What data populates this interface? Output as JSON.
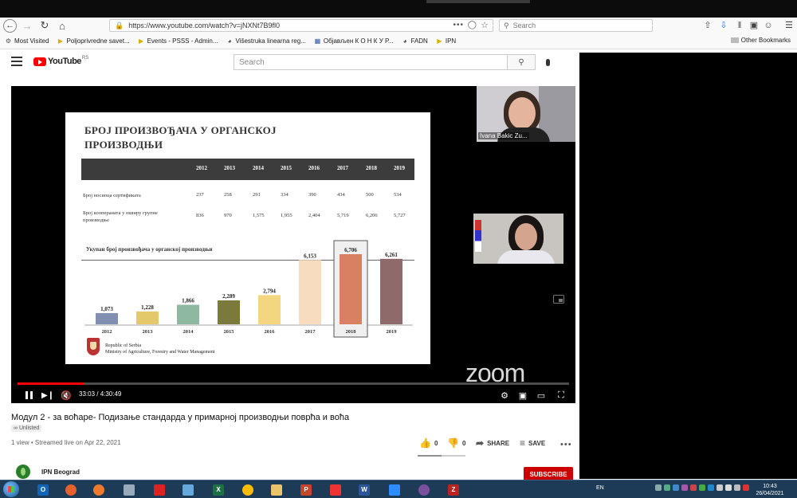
{
  "browser": {
    "url": "https://www.youtube.com/watch?v=jNXNt7B9fl0",
    "search_placeholder": "Search",
    "bookmarks": [
      {
        "label": "Most Visited",
        "icon": "gear-icon",
        "color": "#555555"
      },
      {
        "label": "Poljoprivredne savet...",
        "icon": "star-icon",
        "color": "#d8b000"
      },
      {
        "label": "Events - PSSS - Admin...",
        "icon": "star-icon",
        "color": "#d8b000"
      },
      {
        "label": "Višestruka linearna reg...",
        "icon": "globe-icon",
        "color": "#444444"
      },
      {
        "label": "Објављен К О Н К У Р...",
        "icon": "page-icon",
        "color": "#3355aa"
      },
      {
        "label": "FADN",
        "icon": "globe-icon",
        "color": "#444444"
      },
      {
        "label": "IPN",
        "icon": "star-icon",
        "color": "#d8b000"
      }
    ],
    "other_bookmarks": "Other Bookmarks"
  },
  "youtube": {
    "logo_text": "YouTube",
    "region": "RS",
    "search_placeholder": "Search",
    "video_title": "Модул 2 - за воћаре- Подизање стандарда у примарној производњи поврћа и воћа",
    "visibility": "Unlisted",
    "views_line": "1 view • Streamed live on Apr 22, 2021",
    "likes": "0",
    "dislikes": "0",
    "share_label": "SHARE",
    "save_label": "SAVE",
    "channel_name": "IPN Beograd",
    "subscribe_label": "SUBSCRIBE",
    "time_display": "33:03 / 4:30:49",
    "progress": 0.122
  },
  "slide": {
    "title_line1": "БРОЈ ПРОИЗВОЂАЧА У ОРГАНСКОЈ",
    "title_line2": "ПРОИЗВОДЊИ",
    "years": [
      "2012",
      "2013",
      "2014",
      "2015",
      "2016",
      "2017",
      "2018",
      "2019"
    ],
    "rows": [
      {
        "label": "Број носиоца сертификата",
        "label2": "",
        "values": [
          "237",
          "258",
          "291",
          "334",
          "390",
          "434",
          "500",
          "534"
        ]
      },
      {
        "label": "Број коопераната у оквиру групне",
        "label2": "производње",
        "values": [
          "836",
          "970",
          "1,575",
          "1,955",
          "2,404",
          "5,719",
          "6,206",
          "5,727"
        ]
      }
    ],
    "chart_title": "Укупан број произвођача у органској производњи",
    "footer1": "Republic of Serbia",
    "footer2": "Ministry of Agriculture, Forestry and Water Management"
  },
  "chart_data": {
    "type": "bar",
    "title": "Укупан број произвођача у органској производњи",
    "categories": [
      "2012",
      "2013",
      "2014",
      "2015",
      "2016",
      "2017",
      "2018",
      "2019"
    ],
    "values": [
      1073,
      1228,
      1866,
      2289,
      2794,
      6153,
      6706,
      6261
    ],
    "value_labels": [
      "1,073",
      "1,228",
      "1,866",
      "2,289",
      "2,794",
      "6,153",
      "6,706",
      "6,261"
    ],
    "colors": [
      "#8190b0",
      "#e5c86a",
      "#8fb8a0",
      "#7b7a3c",
      "#f5d680",
      "#f7dcc0",
      "#d98063",
      "#8f6a6a"
    ],
    "highlight": "2018",
    "ylim": [
      0,
      7200
    ]
  },
  "zoom": {
    "watermark": "zoom",
    "participant1": "Ivana Bakic Zu..."
  },
  "taskbar": {
    "lang": "EN",
    "time": "10:43",
    "date": "26/04/2021"
  }
}
